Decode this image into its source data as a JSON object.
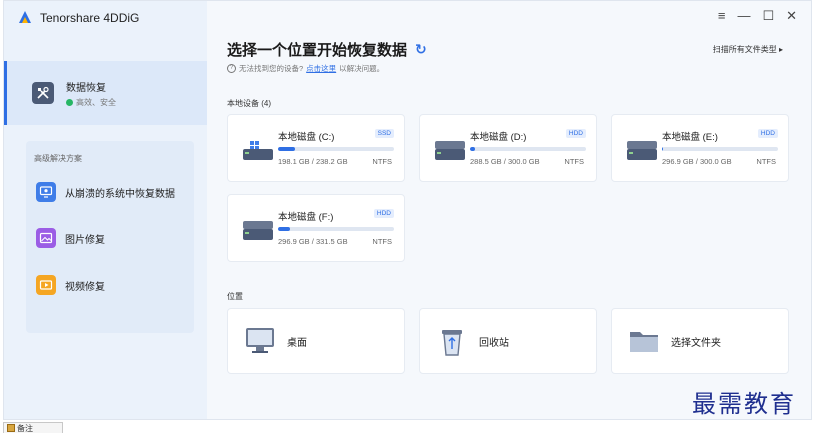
{
  "app": {
    "title": "Tenorshare 4DDiG"
  },
  "sidebar": {
    "active": {
      "label": "数据恢复",
      "status": "高效、安全"
    },
    "advanced": {
      "title": "高级解决方案",
      "items": [
        {
          "label": "从崩溃的系统中恢复数据",
          "icon": "monitor-recover-icon"
        },
        {
          "label": "图片修复",
          "icon": "photo-repair-icon"
        },
        {
          "label": "视频修复",
          "icon": "video-repair-icon"
        }
      ]
    }
  },
  "main": {
    "title": "选择一个位置开始恢复数据",
    "hint_prefix": "无法找到您的设备?",
    "hint_link": "点击这里",
    "hint_suffix": "以解决问题。",
    "scan_all": "扫描所有文件类型",
    "scan_all_arrow": "▸",
    "local_section": "本地设备 (4)",
    "location_section": "位置",
    "drives": [
      {
        "name": "本地磁盘 (C:)",
        "type": "SSD",
        "size": "198.1 GB / 238.2 GB",
        "fs": "NTFS",
        "fill": 0.15
      },
      {
        "name": "本地磁盘 (D:)",
        "type": "HDD",
        "size": "288.5 GB / 300.0 GB",
        "fs": "NTFS",
        "fill": 0.04
      },
      {
        "name": "本地磁盘 (E:)",
        "type": "HDD",
        "size": "296.9 GB / 300.0 GB",
        "fs": "NTFS",
        "fill": 0.01
      },
      {
        "name": "本地磁盘 (F:)",
        "type": "HDD",
        "size": "296.9 GB / 331.5 GB",
        "fs": "NTFS",
        "fill": 0.1
      }
    ],
    "locations": [
      {
        "label": "桌面",
        "icon": "desktop-icon"
      },
      {
        "label": "回收站",
        "icon": "recycle-bin-icon"
      },
      {
        "label": "选择文件夹",
        "icon": "folder-icon"
      }
    ]
  },
  "watermark": "最需教育",
  "taskbar_label": "备注"
}
